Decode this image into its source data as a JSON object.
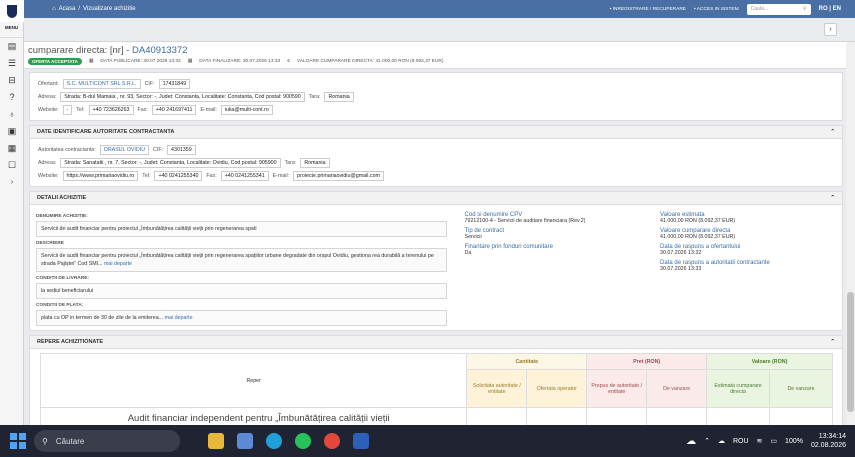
{
  "sidebar": {
    "menu_label": "MENU"
  },
  "topbar": {
    "home_label": "Acasa",
    "separator": "/",
    "crumb": "Vizualizare achizitie",
    "register_label": "INREGISTRARE / RECUPERARE",
    "login_label": "ACCES IN SISTEM",
    "search_placeholder": "Cauta...",
    "lang": "RO | EN"
  },
  "header": {
    "title_prefix": "cumparare directa: [nr] - ",
    "code": "DA40913372",
    "status": "OFERTA ACCEPTATA",
    "date_published": "DATA PUBLICARE: 30.07.2026 13:32",
    "date_final": "DATA FINALIZARE: 30.07.2026 13:33",
    "value": "VALOARE CUMPARARE DIRECTA: 41.000,00 RON (8.092,37 EUR)"
  },
  "ofertant": {
    "label": "Ofertant:",
    "name": "S.C. MULTICONT SRL S.R.L.",
    "cif_label": "CIF:",
    "cif": "17431849",
    "address_label": "Adresa:",
    "address": "Strada: B-dul Mamaia , nr. 93, Sector: -, Judet: Constanta, Localitate: Constanta, Cod postal: 900590",
    "country_label": "Tara:",
    "country": "Romania",
    "website_label": "Website:",
    "website": "-",
    "tel_label": "Tel:",
    "tel": "+40 723626263",
    "fax_label": "Fax:",
    "fax": "+40 241697411",
    "email_label": "E-mail:",
    "email": "iulia@multi-cont.ro"
  },
  "autoritate": {
    "heading": "DATE IDENTIFICARE AUTORITATE CONTRACTANTA",
    "label": "Autoritatea contractanta:",
    "name": "ORASUL OVIDIU",
    "cif_label": "CIF:",
    "cif": "4301359",
    "address_label": "Adresa:",
    "address": "Strada: Sanatatii , nr. 7, Sector: -, Judet: Constanta, Localitate: Ovidiu, Cod postal: 905900",
    "country_label": "Tara:",
    "country": "Romania",
    "website_label": "Website:",
    "website": "https://www.primariaovidiu.ro",
    "tel_label": "Tel:",
    "tel": "+40 0241255340",
    "fax_label": "Fax:",
    "fax": "+40 0241255341",
    "email_label": "E-mail:",
    "email": "proiecte.primariaovidiu@gmail.com"
  },
  "details": {
    "heading": "DETALII ACHIZITIE",
    "denumire_label": "DENUMIRE ACHIZITIE:",
    "denumire": "Servicii de audit financiar pentru proiectul „Îmbunătățirea calității vieții prin regenerarea spati",
    "descriere_label": "DESCRIERE",
    "descriere": "Servicii de audit financiar pentru proiectul „Îmbunătățirea calității vieții prin regenerarea spațiilor urbane degradate din orașul Ovidiu, gestiona rea durabilă a terenului pe strada Pajiștei” Cod SMI...",
    "more_label": "mai departe",
    "livrare_label": "CONDITII DE LIVRARE:",
    "livrare": "la sediul beneficiarului",
    "plata_label": "CONDITII DE PLATA:",
    "plata": "plata cu OP in termen de 30 de zile de la emiterea...",
    "cpv_label": "Cod si denumire CPV",
    "cpv": "79212100-4 - Servicii de auditare financiara (Rev.2)",
    "tip_label": "Tip de contract",
    "tip": "Servicii",
    "fonduri_label": "Finantare prin fonduri comunitare",
    "fonduri": "Da",
    "estimata_label": "Valoare estimata",
    "estimata": "41.000,00  RON (8.092,37  EUR)",
    "cumparare_label": "Valoare cumparare directa",
    "cumparare": "41.000,00  RON (8.092,37  EUR)",
    "raspuns_ofertant_label": "Data de raspuns a ofertantului",
    "raspuns_ofertant": "30.07.2026 13:32",
    "raspuns_autoritate_label": "Data de raspuns a autoritatii contractante",
    "raspuns_autoritate": "30.07.2026 13:33"
  },
  "repere": {
    "heading": "REPERE ACHIZITIONATE",
    "col_reper": "Reper",
    "col_cantitate": "Cantitate",
    "col_pret": "Pret (RON)",
    "col_valoare": "Valoare (RON)",
    "sub_solicitata": "Solicitata autoritate / entitate",
    "sub_oferta": "Ofertata operator",
    "sub_propus": "Propus de autoritate / entitate",
    "sub_vanzare1": "De vanzare",
    "sub_estimata": "Estimata cumparare directa",
    "sub_vanzare2": "De vanzare",
    "row_text": "Audit financiar independent pentru „Îmbunătățirea calității vieții"
  },
  "taskbar": {
    "search_label": "Căutare",
    "lang": "ROU",
    "battery": "100%",
    "time": "13:34:14",
    "date": "02.08.2026"
  },
  "colors": {
    "topbar": "#4a6fa5",
    "accent": "#3a6ea5",
    "status": "#2e9e4e"
  }
}
